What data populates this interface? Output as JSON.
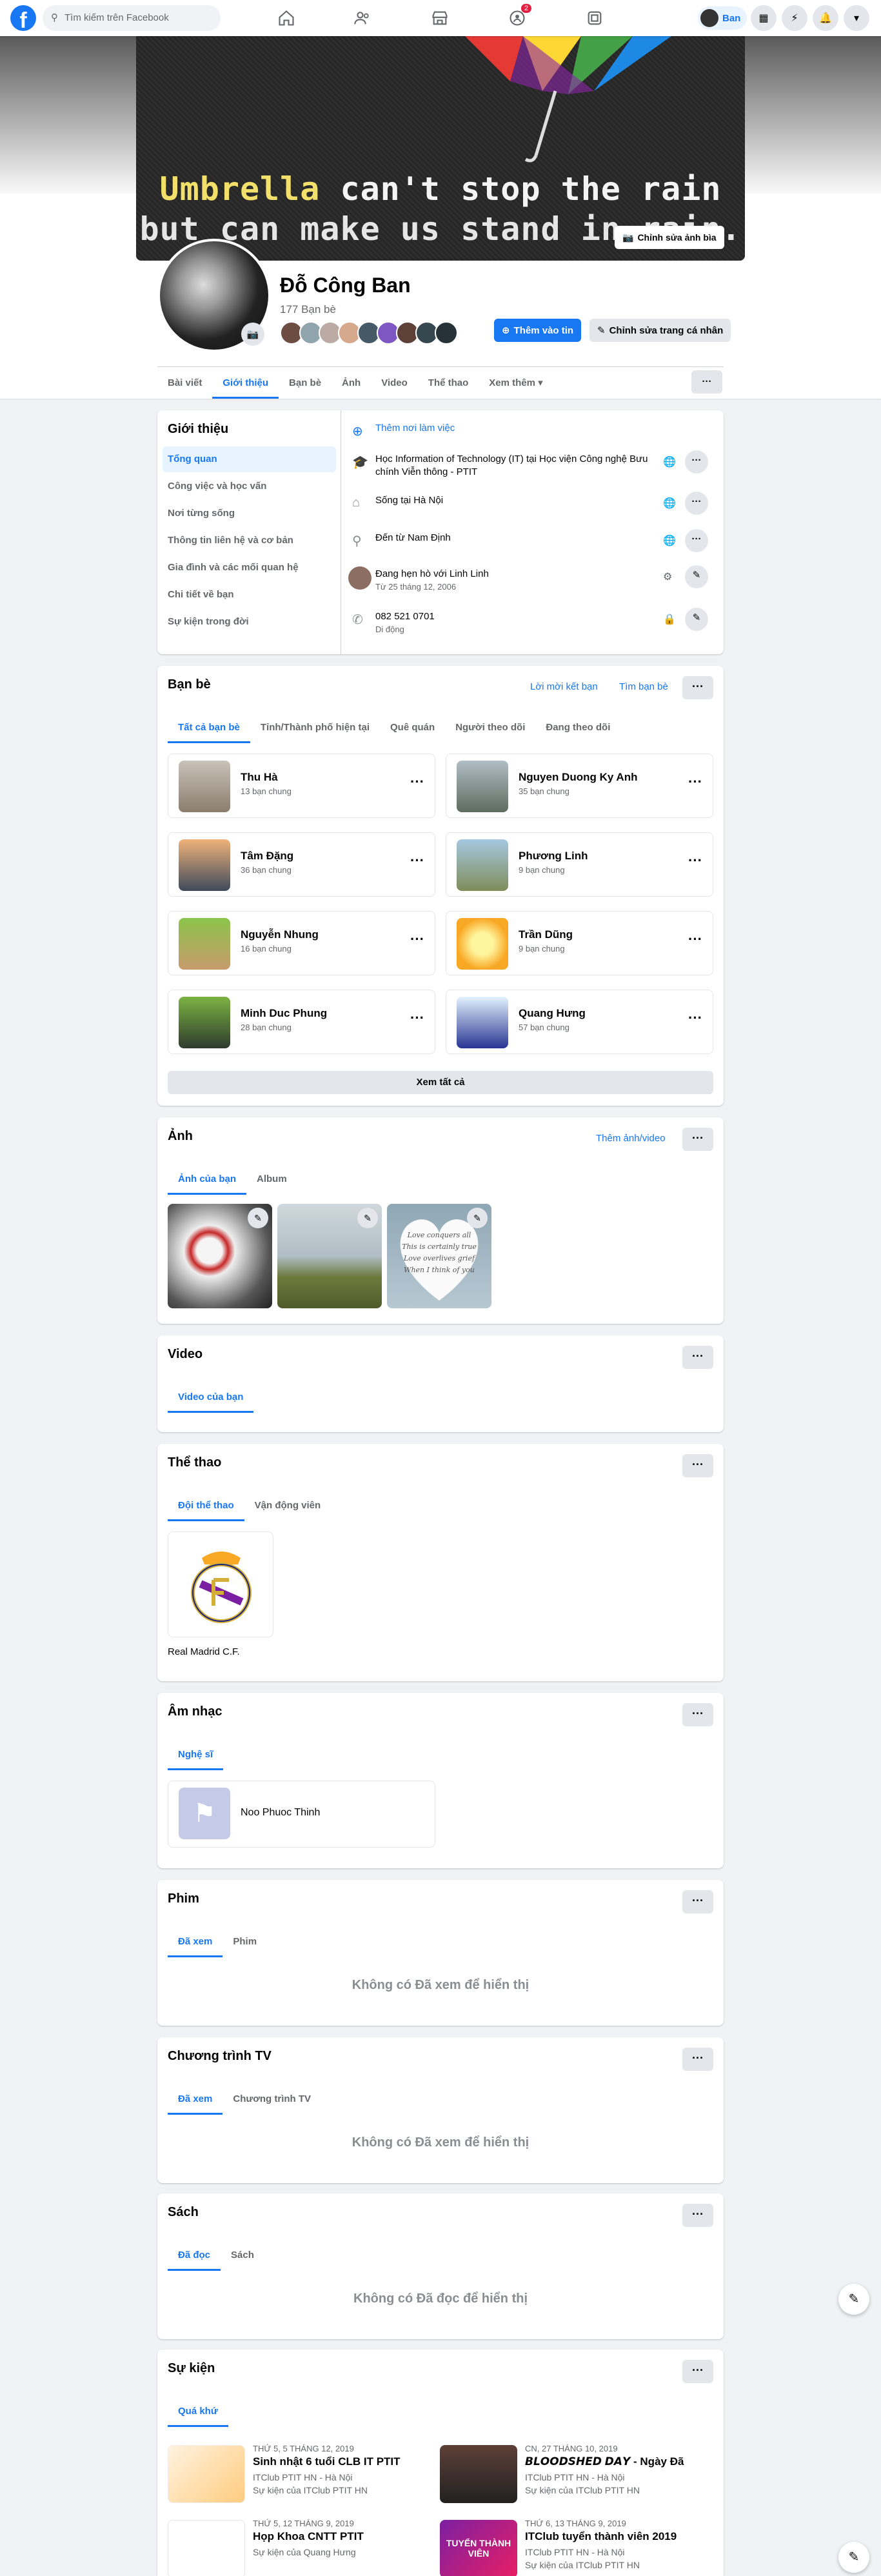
{
  "nav": {
    "search_placeholder": "Tìm kiếm trên Facebook",
    "groups_badge": "2",
    "profile_name": "Ban",
    "brand_color": "#1877f2"
  },
  "cover": {
    "quote_highlight": "Umbrella",
    "quote_rest": " can't stop the rain",
    "quote_line2": "but can make us stand in rain.",
    "edit_label": "Chỉnh sửa ảnh bìa"
  },
  "profile": {
    "name": "Đỗ Công Ban",
    "friends_count": "177 Bạn bè",
    "add_story": "Thêm vào tin",
    "edit_profile": "Chỉnh sửa trang cá nhân",
    "tabs": [
      "Bài viết",
      "Giới thiệu",
      "Bạn bè",
      "Ảnh",
      "Video",
      "Thể thao",
      "Xem thêm ▾"
    ]
  },
  "about": {
    "title": "Giới thiệu",
    "menu": [
      "Tổng quan",
      "Công việc và học vấn",
      "Nơi từng sống",
      "Thông tin liên hệ và cơ bản",
      "Gia đình và các mối quan hệ",
      "Chi tiết về bạn",
      "Sự kiện trong đời"
    ],
    "add_work": "Thêm nơi làm việc",
    "study": "Học Information of Technology (IT) tại Học viện Công nghệ Bưu chính Viễn thông - PTIT",
    "lives": "Sống tại Hà Nội",
    "from": "Đến từ Nam Định",
    "relationship": "Đang hẹn hò với Linh Linh",
    "relationship_since": "Từ 25 tháng 12, 2006",
    "phone": "082 521 0701",
    "phone_type": "Di động"
  },
  "friends": {
    "title": "Bạn bè",
    "requests": "Lời mời kết bạn",
    "find": "Tìm bạn bè",
    "tabs": [
      "Tất cả bạn bè",
      "Tỉnh/Thành phố hiện tại",
      "Quê quán",
      "Người theo dõi",
      "Đang theo dõi"
    ],
    "list": [
      {
        "name": "Thu Hà",
        "mutual": "13 bạn chung"
      },
      {
        "name": "Nguyen Duong Ky Anh",
        "mutual": "35 bạn chung"
      },
      {
        "name": "Tâm Đặng",
        "mutual": "36 bạn chung"
      },
      {
        "name": "Phương Linh",
        "mutual": "9 bạn chung"
      },
      {
        "name": "Nguyễn Nhung",
        "mutual": "16 bạn chung"
      },
      {
        "name": "Trần Dũng",
        "mutual": "9 bạn chung"
      },
      {
        "name": "Minh Duc Phung",
        "mutual": "28 bạn chung"
      },
      {
        "name": "Quang Hưng",
        "mutual": "57 bạn chung"
      }
    ],
    "see_all": "Xem tất cả"
  },
  "photos": {
    "title": "Ảnh",
    "add": "Thêm ảnh/video",
    "tabs": [
      "Ảnh của bạn",
      "Album"
    ],
    "quote_lines": [
      "Love conquers all",
      "This is certainly true",
      "Love overlives grief",
      "When I think of you"
    ]
  },
  "video": {
    "title": "Video",
    "tabs": [
      "Video của bạn"
    ]
  },
  "sports": {
    "title": "Thể thao",
    "tabs": [
      "Đội thể thao",
      "Vận động viên"
    ],
    "team": "Real Madrid C.F."
  },
  "music": {
    "title": "Âm nhạc",
    "tabs": [
      "Nghệ sĩ"
    ],
    "artist": "Noo Phuoc Thinh"
  },
  "movies": {
    "title": "Phim",
    "tabs": [
      "Đã xem",
      "Phim"
    ],
    "empty": "Không có Đã xem để hiển thị"
  },
  "tv": {
    "title": "Chương trình TV",
    "tabs": [
      "Đã xem",
      "Chương trình TV"
    ],
    "empty": "Không có Đã xem để hiển thị"
  },
  "books": {
    "title": "Sách",
    "tabs": [
      "Đã đọc",
      "Sách"
    ],
    "empty": "Không có Đã đọc để hiển thị"
  },
  "events": {
    "title": "Sự kiện",
    "tabs": [
      "Quá khứ"
    ],
    "list": [
      {
        "date": "THỨ 5, 5 THÁNG 12, 2019",
        "title": "Sinh nhật 6 tuổi CLB IT PTIT",
        "loc": "ITClub PTIT HN - Hà Nội",
        "by": "Sự kiện của ITClub PTIT HN"
      },
      {
        "date": "CN, 27 THÁNG 10, 2019",
        "title": "𝘽𝙇𝙊𝙊𝘿𝙎𝙃𝙀𝘿 𝘿𝘼𝙔 - Ngày Đã",
        "loc": "ITClub PTIT HN - Hà Nội",
        "by": "Sự kiện của ITClub PTIT HN"
      },
      {
        "date": "THỨ 5, 12 THÁNG 9, 2019",
        "title": "Họp Khoa CNTT PTIT",
        "loc": "",
        "by": "Sự kiện của Quang Hưng"
      },
      {
        "date": "THỨ 6, 13 THÁNG 9, 2019",
        "title": "ITClub tuyển thành viên 2019",
        "loc": "ITClub PTIT HN - Hà Nội",
        "by": "Sự kiện của ITClub PTIT HN"
      }
    ],
    "event_image_text": "TUYỂN THÀNH VIÊN"
  }
}
